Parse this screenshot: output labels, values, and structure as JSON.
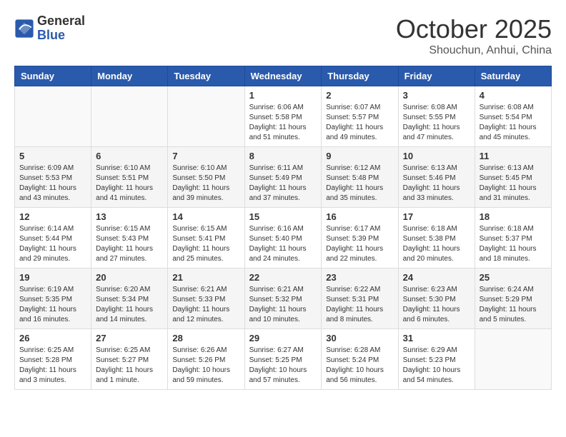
{
  "header": {
    "logo": {
      "line1": "General",
      "line2": "Blue"
    },
    "title": "October 2025",
    "subtitle": "Shouchun, Anhui, China"
  },
  "weekdays": [
    "Sunday",
    "Monday",
    "Tuesday",
    "Wednesday",
    "Thursday",
    "Friday",
    "Saturday"
  ],
  "weeks": [
    [
      {
        "day": "",
        "info": ""
      },
      {
        "day": "",
        "info": ""
      },
      {
        "day": "",
        "info": ""
      },
      {
        "day": "1",
        "info": "Sunrise: 6:06 AM\nSunset: 5:58 PM\nDaylight: 11 hours\nand 51 minutes."
      },
      {
        "day": "2",
        "info": "Sunrise: 6:07 AM\nSunset: 5:57 PM\nDaylight: 11 hours\nand 49 minutes."
      },
      {
        "day": "3",
        "info": "Sunrise: 6:08 AM\nSunset: 5:55 PM\nDaylight: 11 hours\nand 47 minutes."
      },
      {
        "day": "4",
        "info": "Sunrise: 6:08 AM\nSunset: 5:54 PM\nDaylight: 11 hours\nand 45 minutes."
      }
    ],
    [
      {
        "day": "5",
        "info": "Sunrise: 6:09 AM\nSunset: 5:53 PM\nDaylight: 11 hours\nand 43 minutes."
      },
      {
        "day": "6",
        "info": "Sunrise: 6:10 AM\nSunset: 5:51 PM\nDaylight: 11 hours\nand 41 minutes."
      },
      {
        "day": "7",
        "info": "Sunrise: 6:10 AM\nSunset: 5:50 PM\nDaylight: 11 hours\nand 39 minutes."
      },
      {
        "day": "8",
        "info": "Sunrise: 6:11 AM\nSunset: 5:49 PM\nDaylight: 11 hours\nand 37 minutes."
      },
      {
        "day": "9",
        "info": "Sunrise: 6:12 AM\nSunset: 5:48 PM\nDaylight: 11 hours\nand 35 minutes."
      },
      {
        "day": "10",
        "info": "Sunrise: 6:13 AM\nSunset: 5:46 PM\nDaylight: 11 hours\nand 33 minutes."
      },
      {
        "day": "11",
        "info": "Sunrise: 6:13 AM\nSunset: 5:45 PM\nDaylight: 11 hours\nand 31 minutes."
      }
    ],
    [
      {
        "day": "12",
        "info": "Sunrise: 6:14 AM\nSunset: 5:44 PM\nDaylight: 11 hours\nand 29 minutes."
      },
      {
        "day": "13",
        "info": "Sunrise: 6:15 AM\nSunset: 5:43 PM\nDaylight: 11 hours\nand 27 minutes."
      },
      {
        "day": "14",
        "info": "Sunrise: 6:15 AM\nSunset: 5:41 PM\nDaylight: 11 hours\nand 25 minutes."
      },
      {
        "day": "15",
        "info": "Sunrise: 6:16 AM\nSunset: 5:40 PM\nDaylight: 11 hours\nand 24 minutes."
      },
      {
        "day": "16",
        "info": "Sunrise: 6:17 AM\nSunset: 5:39 PM\nDaylight: 11 hours\nand 22 minutes."
      },
      {
        "day": "17",
        "info": "Sunrise: 6:18 AM\nSunset: 5:38 PM\nDaylight: 11 hours\nand 20 minutes."
      },
      {
        "day": "18",
        "info": "Sunrise: 6:18 AM\nSunset: 5:37 PM\nDaylight: 11 hours\nand 18 minutes."
      }
    ],
    [
      {
        "day": "19",
        "info": "Sunrise: 6:19 AM\nSunset: 5:35 PM\nDaylight: 11 hours\nand 16 minutes."
      },
      {
        "day": "20",
        "info": "Sunrise: 6:20 AM\nSunset: 5:34 PM\nDaylight: 11 hours\nand 14 minutes."
      },
      {
        "day": "21",
        "info": "Sunrise: 6:21 AM\nSunset: 5:33 PM\nDaylight: 11 hours\nand 12 minutes."
      },
      {
        "day": "22",
        "info": "Sunrise: 6:21 AM\nSunset: 5:32 PM\nDaylight: 11 hours\nand 10 minutes."
      },
      {
        "day": "23",
        "info": "Sunrise: 6:22 AM\nSunset: 5:31 PM\nDaylight: 11 hours\nand 8 minutes."
      },
      {
        "day": "24",
        "info": "Sunrise: 6:23 AM\nSunset: 5:30 PM\nDaylight: 11 hours\nand 6 minutes."
      },
      {
        "day": "25",
        "info": "Sunrise: 6:24 AM\nSunset: 5:29 PM\nDaylight: 11 hours\nand 5 minutes."
      }
    ],
    [
      {
        "day": "26",
        "info": "Sunrise: 6:25 AM\nSunset: 5:28 PM\nDaylight: 11 hours\nand 3 minutes."
      },
      {
        "day": "27",
        "info": "Sunrise: 6:25 AM\nSunset: 5:27 PM\nDaylight: 11 hours\nand 1 minute."
      },
      {
        "day": "28",
        "info": "Sunrise: 6:26 AM\nSunset: 5:26 PM\nDaylight: 10 hours\nand 59 minutes."
      },
      {
        "day": "29",
        "info": "Sunrise: 6:27 AM\nSunset: 5:25 PM\nDaylight: 10 hours\nand 57 minutes."
      },
      {
        "day": "30",
        "info": "Sunrise: 6:28 AM\nSunset: 5:24 PM\nDaylight: 10 hours\nand 56 minutes."
      },
      {
        "day": "31",
        "info": "Sunrise: 6:29 AM\nSunset: 5:23 PM\nDaylight: 10 hours\nand 54 minutes."
      },
      {
        "day": "",
        "info": ""
      }
    ]
  ]
}
